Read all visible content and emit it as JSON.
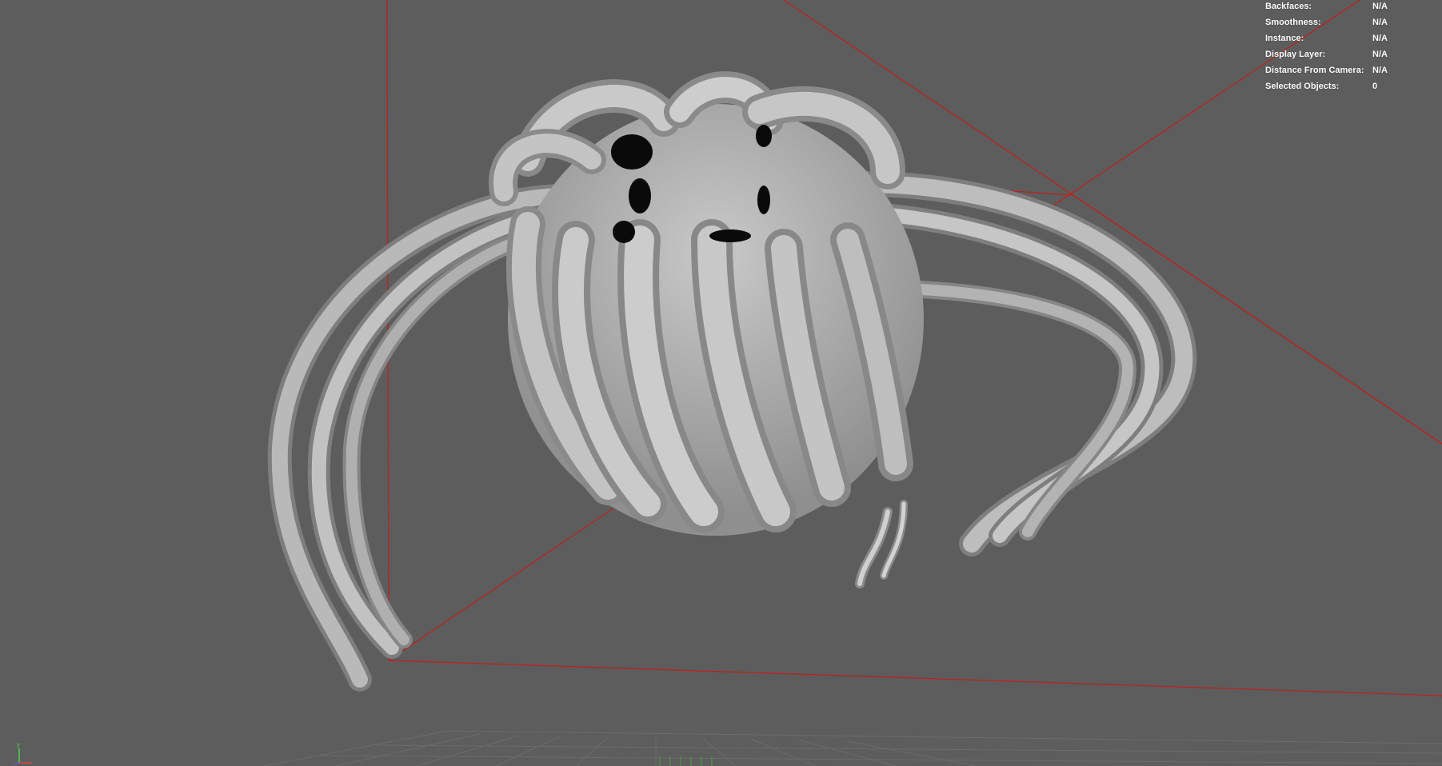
{
  "hud": {
    "rows": [
      {
        "label": "Backfaces:",
        "value": "N/A"
      },
      {
        "label": "Smoothness:",
        "value": "N/A"
      },
      {
        "label": "Instance:",
        "value": "N/A"
      },
      {
        "label": "Display Layer:",
        "value": "N/A"
      },
      {
        "label": "Distance From Camera:",
        "value": "N/A"
      },
      {
        "label": "Selected Objects:",
        "value": "0"
      }
    ]
  },
  "axis": {
    "y": "y"
  },
  "colors": {
    "background": "#5d5d5d",
    "bounding_box": "#c0201c",
    "mesh": "#bdbdbd",
    "hud_text": "#ffffff"
  }
}
